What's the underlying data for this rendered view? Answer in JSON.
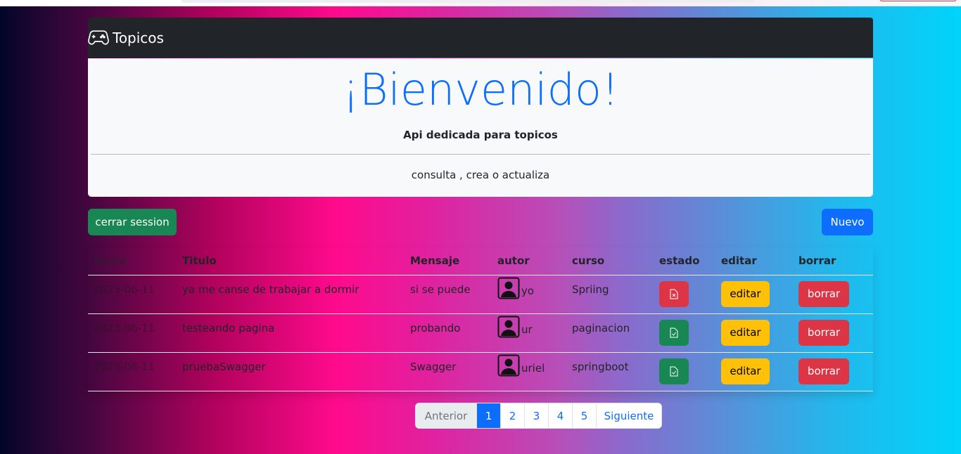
{
  "navbar": {
    "brand": "Topicos"
  },
  "hero": {
    "title": "¡Bienvenido!",
    "subtitle": "Api dedicada para topicos",
    "tagline": "consulta , crea o actualiza"
  },
  "actions": {
    "logout": "cerrar session",
    "new": "Nuevo"
  },
  "table": {
    "headers": [
      "fecha",
      "Titulo",
      "Mensaje",
      "autor",
      "curso",
      "estado",
      "editar",
      "borrar"
    ],
    "rows": [
      {
        "fecha": "2023-06-11",
        "titulo": "ya me canse de trabajar a dormir",
        "mensaje": "si se puede",
        "autor": "yo",
        "curso": "Spriing",
        "estado": "closed",
        "editar": "editar",
        "borrar": "borrar"
      },
      {
        "fecha": "2023-06-11",
        "titulo": "testeando pagina",
        "mensaje": "probando",
        "autor": "ur",
        "curso": "paginacion",
        "estado": "open",
        "editar": "editar",
        "borrar": "borrar"
      },
      {
        "fecha": "2023-06-11",
        "titulo": "pruebaSwagger",
        "mensaje": "Swagger",
        "autor": "uriel",
        "curso": "springboot",
        "estado": "open",
        "editar": "editar",
        "borrar": "borrar"
      }
    ]
  },
  "pagination": {
    "prev": "Anterior",
    "pages": [
      "1",
      "2",
      "3",
      "4",
      "5"
    ],
    "active": "1",
    "next": "Siguiente"
  },
  "colors": {
    "primary": "#0d6efd",
    "success": "#198754",
    "danger": "#dc3545",
    "warning": "#ffc107",
    "dark": "#212529"
  },
  "icons": {
    "brand": "controller-icon",
    "avatar": "person-square-icon",
    "estado_closed": "file-x-icon",
    "estado_open": "file-check-icon"
  }
}
